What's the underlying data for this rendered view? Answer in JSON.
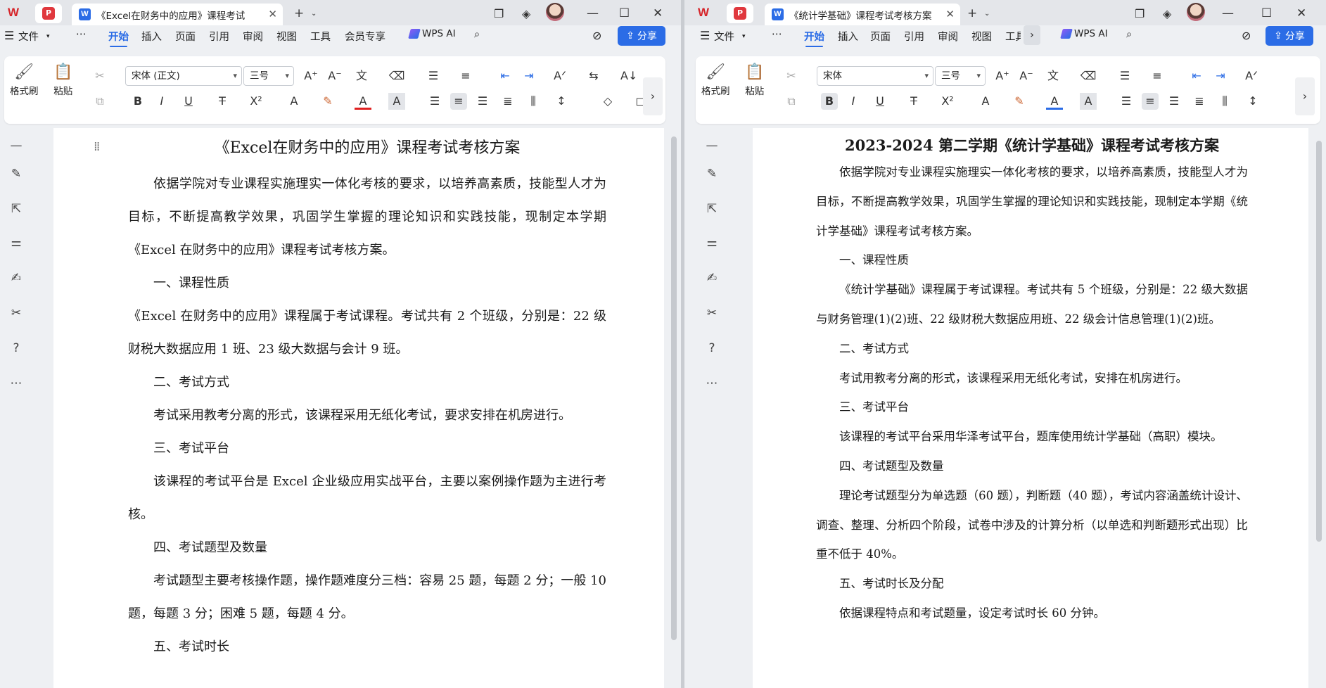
{
  "left_window": {
    "tabs": {
      "pdf_icon": "P",
      "doc_tab_icon": "W",
      "doc_tab_title": "《Excel在财务中的应用》课程考试",
      "new_tab": "+"
    },
    "menu": {
      "file": "文件",
      "more": "⋯",
      "ribbon_tabs": [
        "开始",
        "插入",
        "页面",
        "引用",
        "审阅",
        "视图",
        "工具",
        "会员专享"
      ],
      "active_tab": "开始",
      "wps_ai": "WPS AI",
      "share": "分享"
    },
    "toolbar": {
      "format_painter": "格式刷",
      "paste": "粘贴",
      "font_name": "宋体 (正文)",
      "font_size": "三号"
    },
    "document": {
      "title": "《Excel在财务中的应用》课程考试考核方案",
      "paragraphs": [
        "依据学院对专业课程实施理实一体化考核的要求，以培养高素质，技能型人才为目标，不断提高教学效果，巩固学生掌握的理论知识和实践技能，现制定本学期《Excel 在财务中的应用》课程考试考核方案。",
        "一、课程性质",
        "《Excel 在财务中的应用》课程属于考试课程。考试共有 2 个班级，分别是：22 级财税大数据应用 1 班、23 级大数据与会计 9 班。",
        "二、考试方式",
        "考试采用教考分离的形式，该课程采用无纸化考试，要求安排在机房进行。",
        "三、考试平台",
        "该课程的考试平台是 Excel 企业级应用实战平台，主要以案例操作题为主进行考核。",
        "四、考试题型及数量",
        "考试题型主要考核操作题，操作题难度分三档：容易 25 题，每题 2 分；一般 10 题，每题 3 分；困难 5 题，每题 4 分。",
        "五、考试时长"
      ]
    }
  },
  "right_window": {
    "tabs": {
      "pdf_icon": "P",
      "doc_tab_icon": "W",
      "doc_tab_title": "《统计学基础》课程考试考核方案",
      "new_tab": "+"
    },
    "menu": {
      "file": "文件",
      "more": "⋯",
      "ribbon_tabs": [
        "开始",
        "插入",
        "页面",
        "引用",
        "审阅",
        "视图",
        "工具"
      ],
      "active_tab": "开始",
      "wps_ai": "WPS AI",
      "share": "分享"
    },
    "toolbar": {
      "format_painter": "格式刷",
      "paste": "粘贴",
      "font_name": "宋体",
      "font_size": "三号"
    },
    "document": {
      "title": "2023-2024 第二学期《统计学基础》课程考试考核方案",
      "paragraphs": [
        "依据学院对专业课程实施理实一体化考核的要求，以培养高素质，技能型人才为目标，不断提高教学效果，巩固学生掌握的理论知识和实践技能，现制定本学期《统计学基础》课程考试考核方案。",
        "一、课程性质",
        "《统计学基础》课程属于考试课程。考试共有 5 个班级，分别是：22 级大数据与财务管理(1)(2)班、22 级财税大数据应用班、22 级会计信息管理(1)(2)班。",
        "二、考试方式",
        "考试用教考分离的形式，该课程采用无纸化考试，安排在机房进行。",
        "三、考试平台",
        "该课程的考试平台采用华泽考试平台，题库使用统计学基础（高职）模块。",
        "四、考试题型及数量",
        "理论考试题型分为单选题（60 题），判断题（40 题），考试内容涵盖统计设计、调查、整理、分析四个阶段，试卷中涉及的计算分析（以单选和判断题形式出现）比重不低于 40%。",
        "五、考试时长及分配",
        "依据课程特点和考试题量，设定考试时长 60 分钟。"
      ]
    }
  },
  "colors": {
    "accent": "#2b6ce6",
    "wps_red": "#d6262b",
    "chrome": "#eef0f3"
  }
}
